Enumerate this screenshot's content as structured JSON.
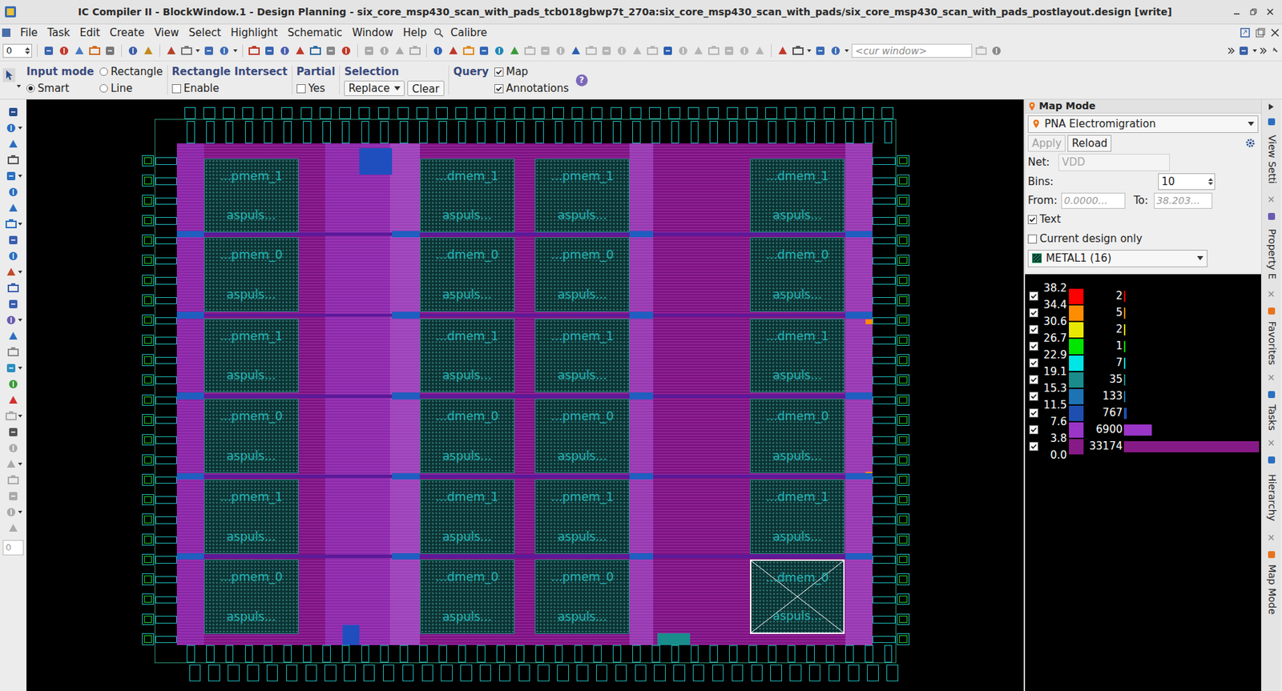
{
  "window": {
    "title": "IC Compiler II - BlockWindow.1 - Design Planning - six_core_msp430_scan_with_pads_tcb018gbwp7t_270a:six_core_msp430_scan_with_pads/six_core_msp430_scan_with_pads_postlayout.design [write]"
  },
  "menu": [
    "File",
    "Task",
    "Edit",
    "Create",
    "View",
    "Select",
    "Highlight",
    "Schematic",
    "Window",
    "Help",
    "Calibre"
  ],
  "toolbar": {
    "spinner": "0",
    "cur_window": "<cur window>"
  },
  "options": {
    "input_mode": {
      "label": "Input mode",
      "choices": [
        {
          "label": "Rectangle",
          "selected": false
        },
        {
          "label": "Smart",
          "selected": true
        },
        {
          "label": "Line",
          "selected": false
        }
      ]
    },
    "rect_intersect": {
      "label": "Rectangle Intersect",
      "check": {
        "label": "Enable",
        "checked": false
      }
    },
    "partial": {
      "label": "Partial",
      "check": {
        "label": "Yes",
        "checked": false
      }
    },
    "selection": {
      "label": "Selection",
      "value": "Replace",
      "button": "Clear"
    },
    "query": {
      "label": "Query",
      "checks": [
        {
          "label": "Map",
          "checked": true
        },
        {
          "label": "Annotations",
          "checked": true
        }
      ]
    },
    "help": "?"
  },
  "left_tools": {
    "field": "0"
  },
  "layout": {
    "macros": [
      {
        "name": "...pmem_1",
        "cell": "aspuls...",
        "selected": false
      },
      {
        "name": "...dmem_1",
        "cell": "aspuls...",
        "selected": false
      },
      {
        "name": "...pmem_1",
        "cell": "aspuls...",
        "selected": false
      },
      {
        "name": "...dmem_1",
        "cell": "aspuls...",
        "selected": false
      },
      {
        "name": "...pmem_0",
        "cell": "aspuls...",
        "selected": false
      },
      {
        "name": "...dmem_0",
        "cell": "aspuls...",
        "selected": false
      },
      {
        "name": "...pmem_0",
        "cell": "aspuls...",
        "selected": false
      },
      {
        "name": "...dmem_0",
        "cell": "aspuls...",
        "selected": false
      },
      {
        "name": "...pmem_1",
        "cell": "aspuls...",
        "selected": false
      },
      {
        "name": "...dmem_1",
        "cell": "aspuls...",
        "selected": false
      },
      {
        "name": "...pmem_1",
        "cell": "aspuls...",
        "selected": false
      },
      {
        "name": "...dmem_1",
        "cell": "aspuls...",
        "selected": false
      },
      {
        "name": "...pmem_0",
        "cell": "aspuls...",
        "selected": false
      },
      {
        "name": "...dmem_0",
        "cell": "aspuls...",
        "selected": false
      },
      {
        "name": "...pmem_0",
        "cell": "aspuls...",
        "selected": false
      },
      {
        "name": "...dmem_0",
        "cell": "aspuls...",
        "selected": false
      },
      {
        "name": "...pmem_1",
        "cell": "aspuls...",
        "selected": false
      },
      {
        "name": "...dmem_1",
        "cell": "aspuls...",
        "selected": false
      },
      {
        "name": "...pmem_1",
        "cell": "aspuls...",
        "selected": false
      },
      {
        "name": "...dmem_1",
        "cell": "aspuls...",
        "selected": false
      },
      {
        "name": "...pmem_0",
        "cell": "aspuls...",
        "selected": false
      },
      {
        "name": "...dmem_0",
        "cell": "aspuls...",
        "selected": false
      },
      {
        "name": "...pmem_0",
        "cell": "aspuls...",
        "selected": false
      },
      {
        "name": "...dmem_0",
        "cell": "aspuls...",
        "selected": true
      }
    ]
  },
  "map_panel": {
    "title": "Map Mode",
    "mode": "PNA Electromigration",
    "apply": {
      "label": "Apply",
      "disabled": true
    },
    "reload": "Reload",
    "net": {
      "label": "Net:",
      "value": "VDD",
      "disabled": true
    },
    "bins": {
      "label": "Bins:",
      "value": "10"
    },
    "from": {
      "label": "From:",
      "value": "0.0000..."
    },
    "to": {
      "label": "To:",
      "value": "38.203..."
    },
    "text_check": {
      "label": "Text",
      "checked": true
    },
    "current_design": {
      "label": "Current design only",
      "checked": false
    },
    "layer": "METAL1 (16)",
    "ticks": [
      "38.2",
      "34.4",
      "30.6",
      "26.7",
      "22.9",
      "19.1",
      "15.3",
      "11.5",
      "7.6",
      "3.8",
      "0.0"
    ],
    "bins_list": [
      {
        "count": "2",
        "color": "#ff0000",
        "level": 6e-05,
        "checked": true
      },
      {
        "count": "5",
        "color": "#ff8c00",
        "level": 0.00015,
        "checked": true
      },
      {
        "count": "2",
        "color": "#e8e800",
        "level": 6e-05,
        "checked": true
      },
      {
        "count": "1",
        "color": "#00e600",
        "level": 3e-05,
        "checked": true
      },
      {
        "count": "7",
        "color": "#00e5e5",
        "level": 0.00021,
        "checked": true
      },
      {
        "count": "35",
        "color": "#1a8c8c",
        "level": 0.00106,
        "checked": true
      },
      {
        "count": "133",
        "color": "#1e73b4",
        "level": 0.004,
        "checked": true
      },
      {
        "count": "767",
        "color": "#1e4fb0",
        "level": 0.0231,
        "checked": true
      },
      {
        "count": "6900",
        "color": "#9a35c8",
        "level": 0.208,
        "checked": true
      },
      {
        "count": "33174",
        "color": "#861a86",
        "level": 1,
        "checked": true
      }
    ]
  },
  "side_tabs": [
    {
      "label": "View Setti",
      "closable": true
    },
    {
      "label": "Property E",
      "closable": true
    },
    {
      "label": "Favorites",
      "closable": true
    },
    {
      "label": "Tasks",
      "closable": true
    },
    {
      "label": "Hierarchy",
      "closable": true
    },
    {
      "label": "Map Mode",
      "closable": false
    }
  ]
}
